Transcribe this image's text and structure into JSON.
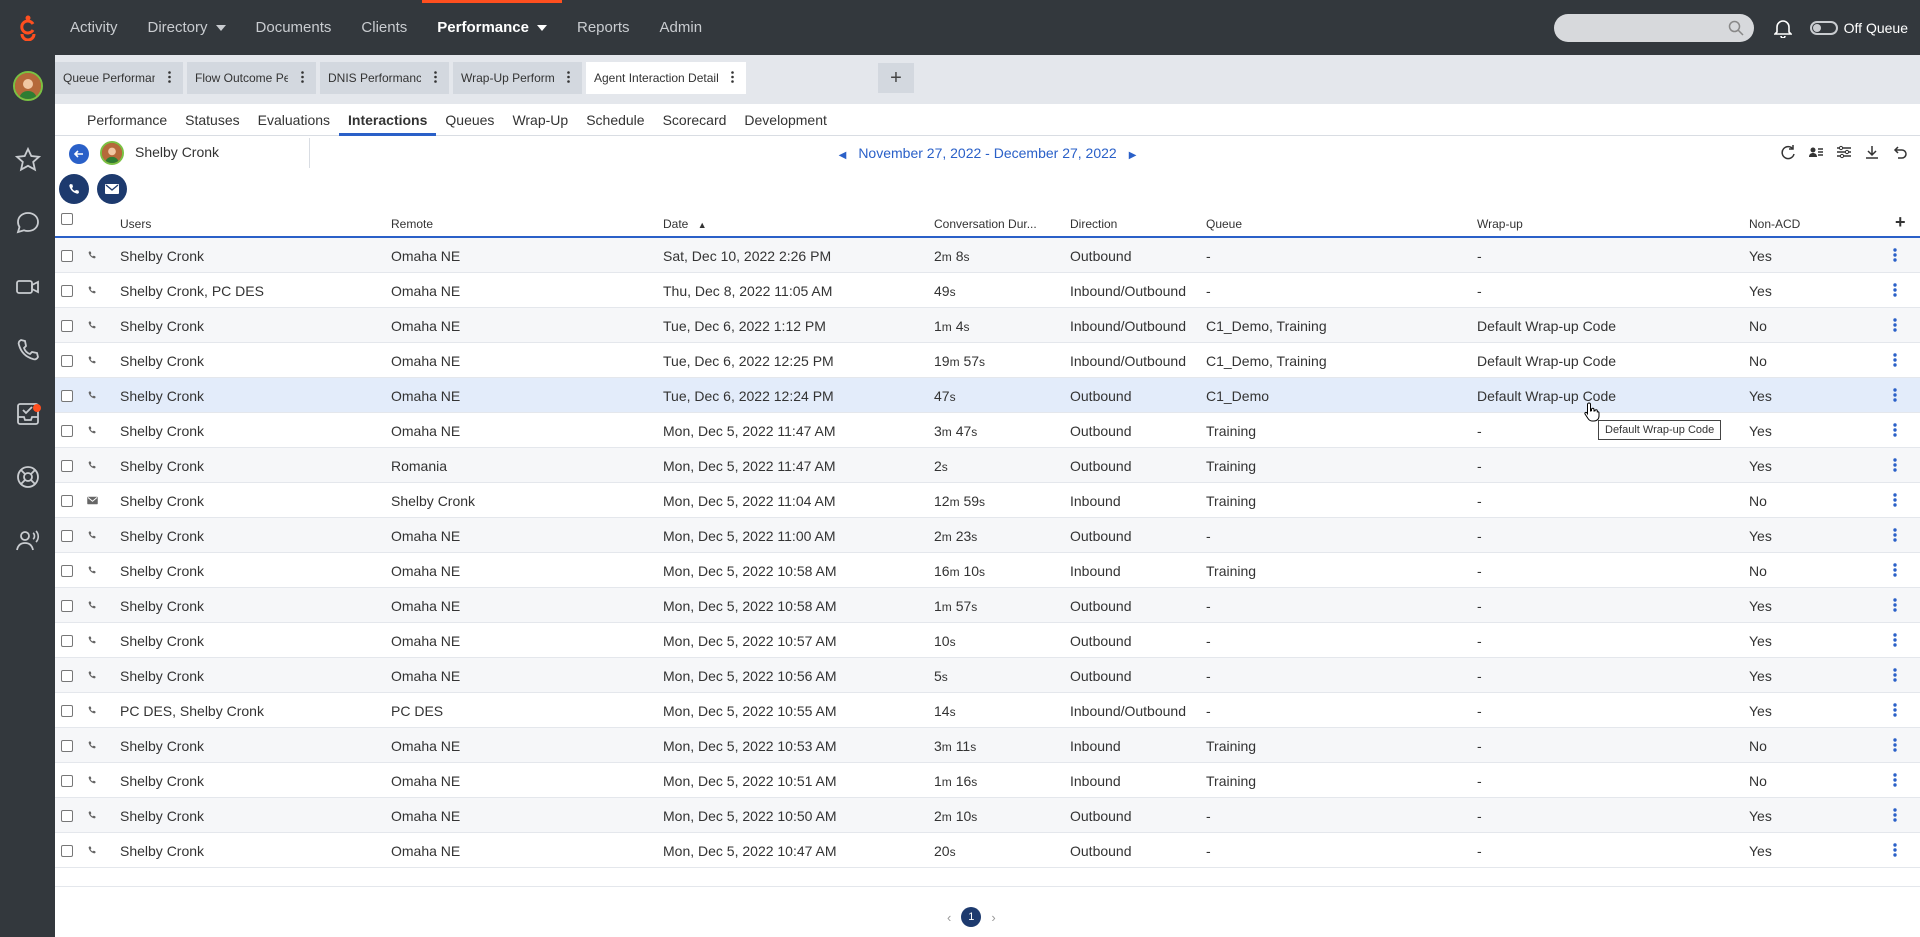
{
  "nav": {
    "items": [
      {
        "label": "Activity",
        "dropdown": false,
        "active": false
      },
      {
        "label": "Directory",
        "dropdown": true,
        "active": false
      },
      {
        "label": "Documents",
        "dropdown": false,
        "active": false
      },
      {
        "label": "Clients",
        "dropdown": false,
        "active": false
      },
      {
        "label": "Performance",
        "dropdown": true,
        "active": true
      },
      {
        "label": "Reports",
        "dropdown": false,
        "active": false
      },
      {
        "label": "Admin",
        "dropdown": false,
        "active": false
      }
    ],
    "search_placeholder": "",
    "queue_status": "Off Queue"
  },
  "page_tabs": [
    {
      "label": "Queue Performance",
      "active": false
    },
    {
      "label": "Flow Outcome Performance",
      "active": false
    },
    {
      "label": "DNIS Performance",
      "active": false
    },
    {
      "label": "Wrap-Up Performance",
      "active": false
    },
    {
      "label": "Agent Interaction Details",
      "active": true
    }
  ],
  "sub_tabs": [
    {
      "label": "Performance",
      "active": false
    },
    {
      "label": "Statuses",
      "active": false
    },
    {
      "label": "Evaluations",
      "active": false
    },
    {
      "label": "Interactions",
      "active": true
    },
    {
      "label": "Queues",
      "active": false
    },
    {
      "label": "Wrap-Up",
      "active": false
    },
    {
      "label": "Schedule",
      "active": false
    },
    {
      "label": "Scorecard",
      "active": false
    },
    {
      "label": "Development",
      "active": false
    }
  ],
  "header": {
    "agent_name": "Shelby Cronk",
    "date_range": "November 27, 2022 - December 27, 2022"
  },
  "columns": {
    "users": "Users",
    "remote": "Remote",
    "date": "Date",
    "duration": "Conversation Dur...",
    "direction": "Direction",
    "queue": "Queue",
    "wrapup": "Wrap-up",
    "nonacd": "Non-ACD"
  },
  "rows": [
    {
      "type": "phone",
      "users": "Shelby Cronk",
      "remote": "Omaha NE",
      "date": "Sat, Dec 10, 2022 2:26 PM",
      "dur": [
        [
          "2",
          "m"
        ],
        [
          "8",
          "s"
        ]
      ],
      "direction": "Outbound",
      "queue": "-",
      "wrapup": "-",
      "nonacd": "Yes"
    },
    {
      "type": "phone",
      "users": "Shelby Cronk, PC DES",
      "remote": "Omaha NE",
      "date": "Thu, Dec 8, 2022 11:05 AM",
      "dur": [
        [
          "49",
          "s"
        ]
      ],
      "direction": "Inbound/Outbound",
      "queue": "-",
      "wrapup": "-",
      "nonacd": "Yes"
    },
    {
      "type": "phone",
      "users": "Shelby Cronk",
      "remote": "Omaha NE",
      "date": "Tue, Dec 6, 2022 1:12 PM",
      "dur": [
        [
          "1",
          "m"
        ],
        [
          "4",
          "s"
        ]
      ],
      "direction": "Inbound/Outbound",
      "queue": "C1_Demo, Training",
      "wrapup": "Default Wrap-up Code",
      "nonacd": "No"
    },
    {
      "type": "phone",
      "users": "Shelby Cronk",
      "remote": "Omaha NE",
      "date": "Tue, Dec 6, 2022 12:25 PM",
      "dur": [
        [
          "19",
          "m"
        ],
        [
          "57",
          "s"
        ]
      ],
      "direction": "Inbound/Outbound",
      "queue": "C1_Demo, Training",
      "wrapup": "Default Wrap-up Code",
      "nonacd": "No"
    },
    {
      "type": "phone",
      "users": "Shelby Cronk",
      "remote": "Omaha NE",
      "date": "Tue, Dec 6, 2022 12:24 PM",
      "dur": [
        [
          "47",
          "s"
        ]
      ],
      "direction": "Outbound",
      "queue": "C1_Demo",
      "wrapup": "Default Wrap-up Code",
      "nonacd": "Yes"
    },
    {
      "type": "phone",
      "users": "Shelby Cronk",
      "remote": "Omaha NE",
      "date": "Mon, Dec 5, 2022 11:47 AM",
      "dur": [
        [
          "3",
          "m"
        ],
        [
          "47",
          "s"
        ]
      ],
      "direction": "Outbound",
      "queue": "Training",
      "wrapup": "-",
      "nonacd": "Yes"
    },
    {
      "type": "phone",
      "users": "Shelby Cronk",
      "remote": "Romania",
      "date": "Mon, Dec 5, 2022 11:47 AM",
      "dur": [
        [
          "2",
          "s"
        ]
      ],
      "direction": "Outbound",
      "queue": "Training",
      "wrapup": "-",
      "nonacd": "Yes"
    },
    {
      "type": "email",
      "users": "Shelby Cronk",
      "remote": "Shelby Cronk",
      "date": "Mon, Dec 5, 2022 11:04 AM",
      "dur": [
        [
          "12",
          "m"
        ],
        [
          "59",
          "s"
        ]
      ],
      "direction": "Inbound",
      "queue": "Training",
      "wrapup": "-",
      "nonacd": "No"
    },
    {
      "type": "phone",
      "users": "Shelby Cronk",
      "remote": "Omaha NE",
      "date": "Mon, Dec 5, 2022 11:00 AM",
      "dur": [
        [
          "2",
          "m"
        ],
        [
          "23",
          "s"
        ]
      ],
      "direction": "Outbound",
      "queue": "-",
      "wrapup": "-",
      "nonacd": "Yes"
    },
    {
      "type": "phone",
      "users": "Shelby Cronk",
      "remote": "Omaha NE",
      "date": "Mon, Dec 5, 2022 10:58 AM",
      "dur": [
        [
          "16",
          "m"
        ],
        [
          "10",
          "s"
        ]
      ],
      "direction": "Inbound",
      "queue": "Training",
      "wrapup": "-",
      "nonacd": "No"
    },
    {
      "type": "phone",
      "users": "Shelby Cronk",
      "remote": "Omaha NE",
      "date": "Mon, Dec 5, 2022 10:58 AM",
      "dur": [
        [
          "1",
          "m"
        ],
        [
          "57",
          "s"
        ]
      ],
      "direction": "Outbound",
      "queue": "-",
      "wrapup": "-",
      "nonacd": "Yes"
    },
    {
      "type": "phone",
      "users": "Shelby Cronk",
      "remote": "Omaha NE",
      "date": "Mon, Dec 5, 2022 10:57 AM",
      "dur": [
        [
          "10",
          "s"
        ]
      ],
      "direction": "Outbound",
      "queue": "-",
      "wrapup": "-",
      "nonacd": "Yes"
    },
    {
      "type": "phone",
      "users": "Shelby Cronk",
      "remote": "Omaha NE",
      "date": "Mon, Dec 5, 2022 10:56 AM",
      "dur": [
        [
          "5",
          "s"
        ]
      ],
      "direction": "Outbound",
      "queue": "-",
      "wrapup": "-",
      "nonacd": "Yes"
    },
    {
      "type": "phone",
      "users": "PC DES, Shelby Cronk",
      "remote": "PC DES",
      "date": "Mon, Dec 5, 2022 10:55 AM",
      "dur": [
        [
          "14",
          "s"
        ]
      ],
      "direction": "Inbound/Outbound",
      "queue": "-",
      "wrapup": "-",
      "nonacd": "Yes"
    },
    {
      "type": "phone",
      "users": "Shelby Cronk",
      "remote": "Omaha NE",
      "date": "Mon, Dec 5, 2022 10:53 AM",
      "dur": [
        [
          "3",
          "m"
        ],
        [
          "11",
          "s"
        ]
      ],
      "direction": "Inbound",
      "queue": "Training",
      "wrapup": "-",
      "nonacd": "No"
    },
    {
      "type": "phone",
      "users": "Shelby Cronk",
      "remote": "Omaha NE",
      "date": "Mon, Dec 5, 2022 10:51 AM",
      "dur": [
        [
          "1",
          "m"
        ],
        [
          "16",
          "s"
        ]
      ],
      "direction": "Inbound",
      "queue": "Training",
      "wrapup": "-",
      "nonacd": "No"
    },
    {
      "type": "phone",
      "users": "Shelby Cronk",
      "remote": "Omaha NE",
      "date": "Mon, Dec 5, 2022 10:50 AM",
      "dur": [
        [
          "2",
          "m"
        ],
        [
          "10",
          "s"
        ]
      ],
      "direction": "Outbound",
      "queue": "-",
      "wrapup": "-",
      "nonacd": "Yes"
    },
    {
      "type": "phone",
      "users": "Shelby Cronk",
      "remote": "Omaha NE",
      "date": "Mon, Dec 5, 2022 10:47 AM",
      "dur": [
        [
          "20",
          "s"
        ]
      ],
      "direction": "Outbound",
      "queue": "-",
      "wrapup": "-",
      "nonacd": "Yes"
    }
  ],
  "highlighted_row": 4,
  "tooltip": "Default Wrap-up Code",
  "pager": {
    "current": "1"
  },
  "colors": {
    "accent": "#2a60c8",
    "brand": "#ff4f1f",
    "topbar": "#33383d"
  }
}
